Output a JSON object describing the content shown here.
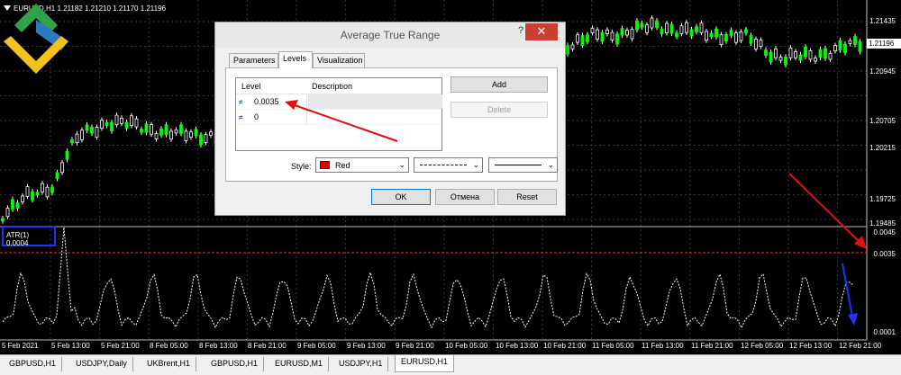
{
  "chart": {
    "symbol_title": "EURUSD,H1  1.21182 1.21210 1.21170 1.21196",
    "current_price": "1.21196",
    "price_labels": [
      "1.21435",
      "1.20945",
      "1.20705",
      "1.20215",
      "1.19725",
      "1.19485"
    ],
    "atr_labels": [
      "0.0045",
      "0.0035",
      "0.0001"
    ],
    "time_labels": [
      "5 Feb 2021",
      "5 Feb 13:00",
      "5 Feb 21:00",
      "8 Feb 05:00",
      "8 Feb 13:00",
      "8 Feb 21:00",
      "9 Feb 05:00",
      "9 Feb 13:00",
      "9 Feb 21:00",
      "10 Feb 05:00",
      "10 Feb 13:00",
      "10 Feb 21:00",
      "11 Feb 05:00",
      "11 Feb 13:00",
      "11 Feb 21:00",
      "12 Feb 05:00",
      "12 Feb 13:00",
      "12 Feb 21:00"
    ],
    "atr_indicator_label": "ATR(1) 0.0004",
    "colors": {
      "bull": "#ffffff",
      "bear": "#00ff00",
      "atr_line": "#ffffff",
      "level_line": "#ff2b2b",
      "grid": "#3a3a3a",
      "annotation_red": "#e01010",
      "annotation_blue": "#1e34ff"
    }
  },
  "dialog": {
    "title": "Average True Range",
    "help_label": "?",
    "close_label": "✕",
    "tabs": [
      {
        "label": "Parameters",
        "active": false
      },
      {
        "label": "Levels",
        "active": true
      },
      {
        "label": "Visualization",
        "active": false
      }
    ],
    "table": {
      "col_level": "Level",
      "col_description": "Description",
      "rows": [
        {
          "level": "0.0035",
          "description": ""
        },
        {
          "level": "0",
          "description": ""
        }
      ]
    },
    "add_label": "Add",
    "delete_label": "Delete",
    "style_label": "Style:",
    "style_color": "Red",
    "style_color_hex": "#e00000",
    "ok_label": "OK",
    "cancel_label": "Отмена",
    "reset_label": "Reset"
  },
  "bottom_tabs": [
    {
      "label": "GBPUSD,H1",
      "active": false
    },
    {
      "label": "USDJPY,Daily",
      "active": false
    },
    {
      "label": "UKBrent,H1",
      "active": false
    },
    {
      "label": "GBPUSD,H1",
      "active": false
    },
    {
      "label": "EURUSD,M1",
      "active": false
    },
    {
      "label": "USDJPY,H1",
      "active": false
    },
    {
      "label": "EURUSD,H1",
      "active": true
    }
  ]
}
